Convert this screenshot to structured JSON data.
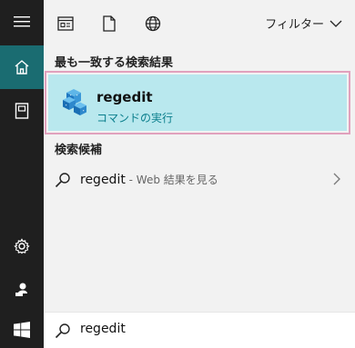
{
  "rail": {
    "icons": [
      "hamburger-menu-icon",
      "home-icon",
      "documents-icon",
      "gear-icon",
      "person-icon",
      "windows-logo-icon"
    ]
  },
  "topbar": {
    "icons": [
      "apps-icon",
      "document-icon",
      "globe-icon"
    ],
    "filter_label": "フィルター"
  },
  "best_match": {
    "header": "最も一致する検索結果",
    "name": "regedit",
    "subtitle": "コマンドの実行"
  },
  "suggestions": {
    "header": "検索候補",
    "items": [
      {
        "query": "regedit",
        "suffix": " - Web 結果を見る"
      }
    ]
  },
  "search": {
    "value": "regedit"
  },
  "colors": {
    "rail_bg": "#1f1f1f",
    "rail_active": "#1a6c71",
    "highlight_bg": "#b9e8ee",
    "highlight_border": "#e1a1bd",
    "accent_text": "#0a7e8c"
  }
}
